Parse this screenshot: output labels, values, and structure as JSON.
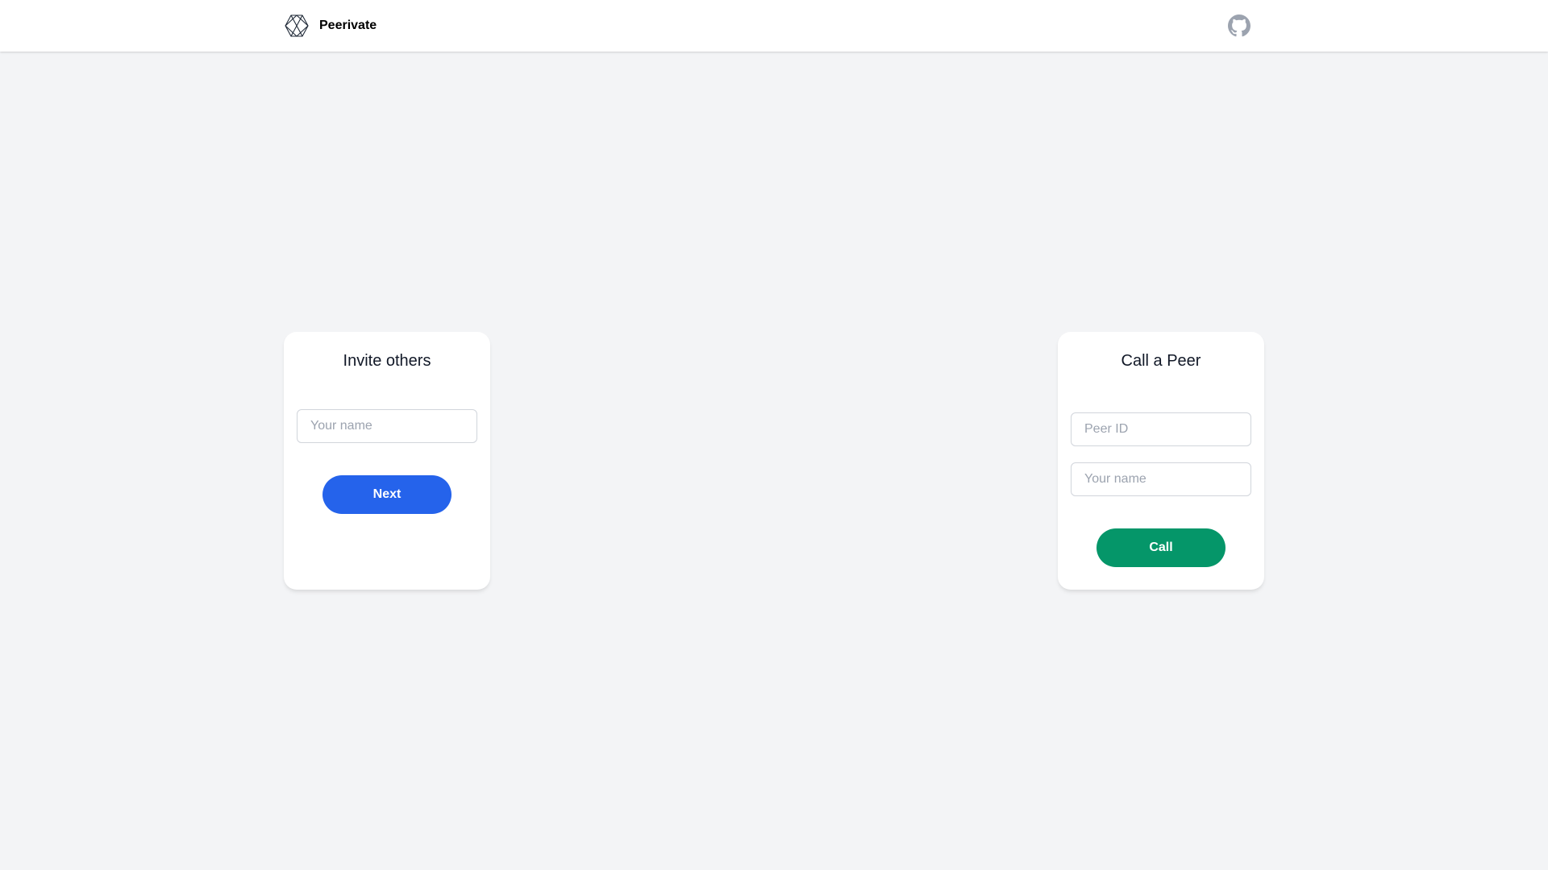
{
  "header": {
    "brand_name": "Peerivate",
    "logo_icon": "hexagon-logo-icon",
    "github_icon": "github-icon",
    "github_icon_color": "#9ca3af"
  },
  "invite_card": {
    "title": "Invite others",
    "name_placeholder": "Your name",
    "next_label": "Next",
    "button_color": "#2563eb"
  },
  "call_card": {
    "title": "Call a Peer",
    "peer_id_placeholder": "Peer ID",
    "name_placeholder": "Your name",
    "call_label": "Call",
    "button_color": "#059669"
  },
  "colors": {
    "background": "#f3f4f6",
    "card": "#ffffff",
    "input_border": "#d1d5db",
    "placeholder": "#9ca3af"
  }
}
